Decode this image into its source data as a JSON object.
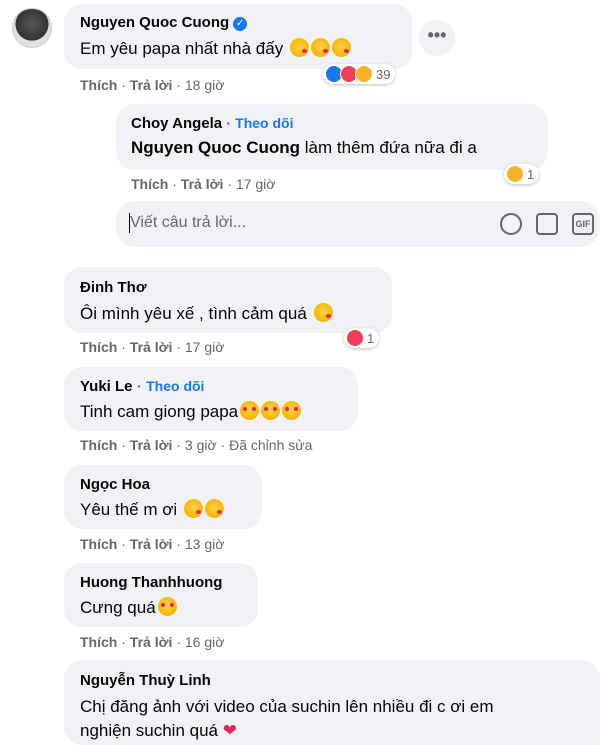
{
  "comments": [
    {
      "author": "Nguyen Quoc Cuong",
      "verified": true,
      "text": "Em yêu papa nhất nhà đấy",
      "emojis": [
        "kiss-emoji",
        "kiss-emoji",
        "kiss-emoji"
      ],
      "like": "Thích",
      "reply": "Trả lời",
      "time": "18 giờ",
      "reaction_count": "39"
    },
    {
      "author": "Choy Angela",
      "follow": "Theo dõi",
      "mention": "Nguyen Quoc Cuong",
      "text": " làm thêm đứa nữa đi a",
      "like": "Thích",
      "reply": "Trả lời",
      "time": "17 giờ",
      "reaction_count": "1"
    },
    {
      "author": "Đinh Thơ",
      "text": "Ôi mình yêu xế , tình cảm quá",
      "like": "Thích",
      "reply": "Trả lời",
      "time": "17 giờ",
      "reaction_count": "1"
    },
    {
      "author": "Yuki Le",
      "follow": "Theo dõi",
      "text": "Tinh cam giong papa",
      "like": "Thích",
      "reply": "Trả lời",
      "time": "3 giờ",
      "edited": "Đã chỉnh sửa"
    },
    {
      "author": "Ngọc Hoa",
      "text": "Yêu thế m ơi",
      "like": "Thích",
      "reply": "Trả lời",
      "time": "13 giờ"
    },
    {
      "author": "Huong Thanhhuong",
      "text": "Cưng quá",
      "like": "Thích",
      "reply": "Trả lời",
      "time": "16 giờ"
    },
    {
      "author": "Nguyễn Thuỳ Linh",
      "text_line1": "Chị đăng ảnh với video của suchin lên nhiều đi c ơi em",
      "text_line2": "nghiện suchin quá"
    }
  ],
  "reply_box": {
    "placeholder": "Viết câu trả lời...",
    "icons": [
      "emoji-icon",
      "camera-icon",
      "gif-icon"
    ],
    "gif_label": "GIF"
  },
  "separator": "·",
  "more_icon": "•••",
  "colors": {
    "link": "#1877f2",
    "meta": "#65676b",
    "bubble": "#f0f2f5"
  }
}
